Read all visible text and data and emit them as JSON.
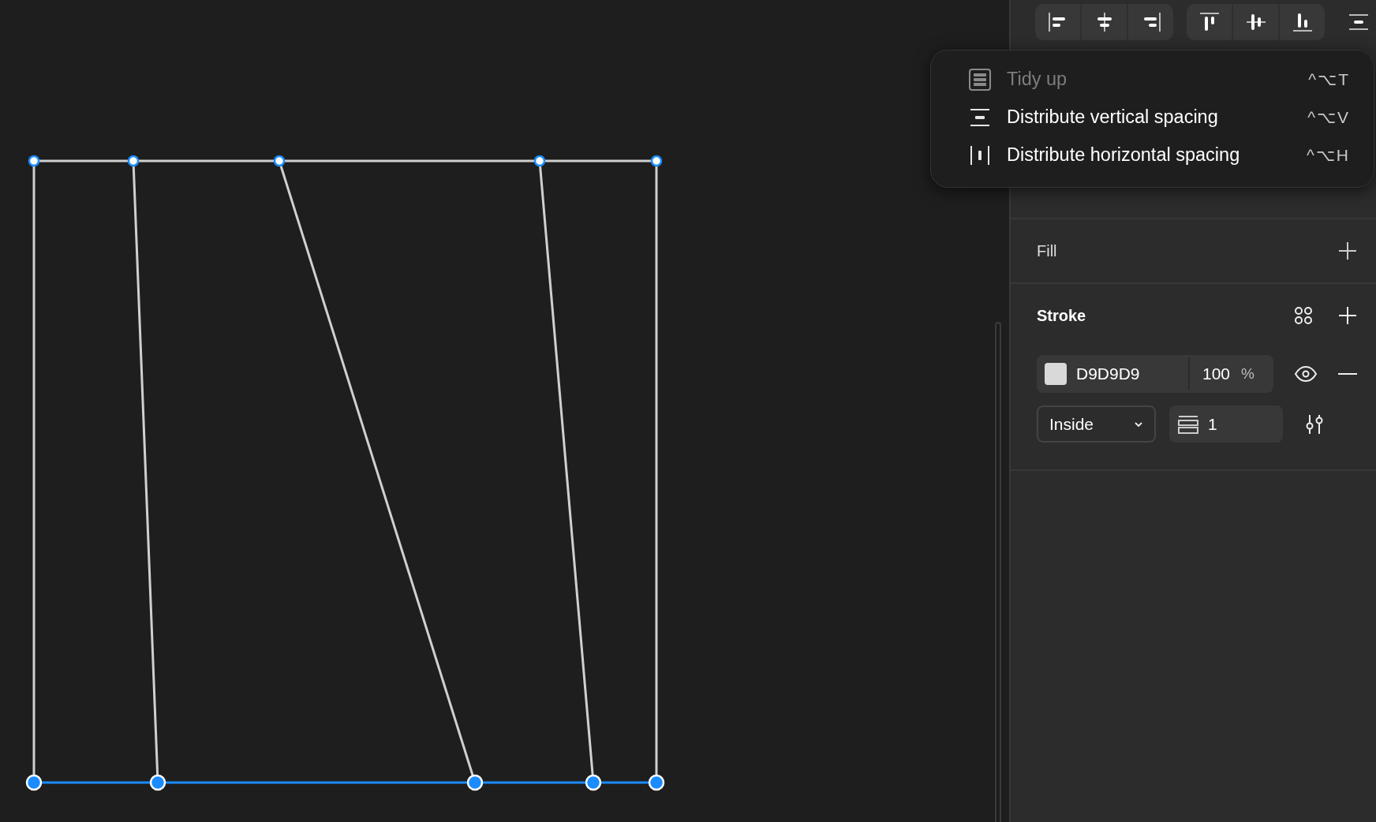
{
  "menu": {
    "items": [
      {
        "label": "Tidy up",
        "shortcut": "^⌥T",
        "disabled": true,
        "kind": "tidy"
      },
      {
        "label": "Distribute vertical spacing",
        "shortcut": "^⌥V",
        "disabled": false,
        "kind": "vertical"
      },
      {
        "label": "Distribute horizontal spacing",
        "shortcut": "^⌥H",
        "disabled": false,
        "kind": "horizontal"
      }
    ]
  },
  "fill": {
    "title": "Fill"
  },
  "stroke": {
    "title": "Stroke",
    "color": "#d9d9d9",
    "hex": "D9D9D9",
    "opacity": "100",
    "unit": "%",
    "position": "Inside",
    "weight": "1"
  }
}
